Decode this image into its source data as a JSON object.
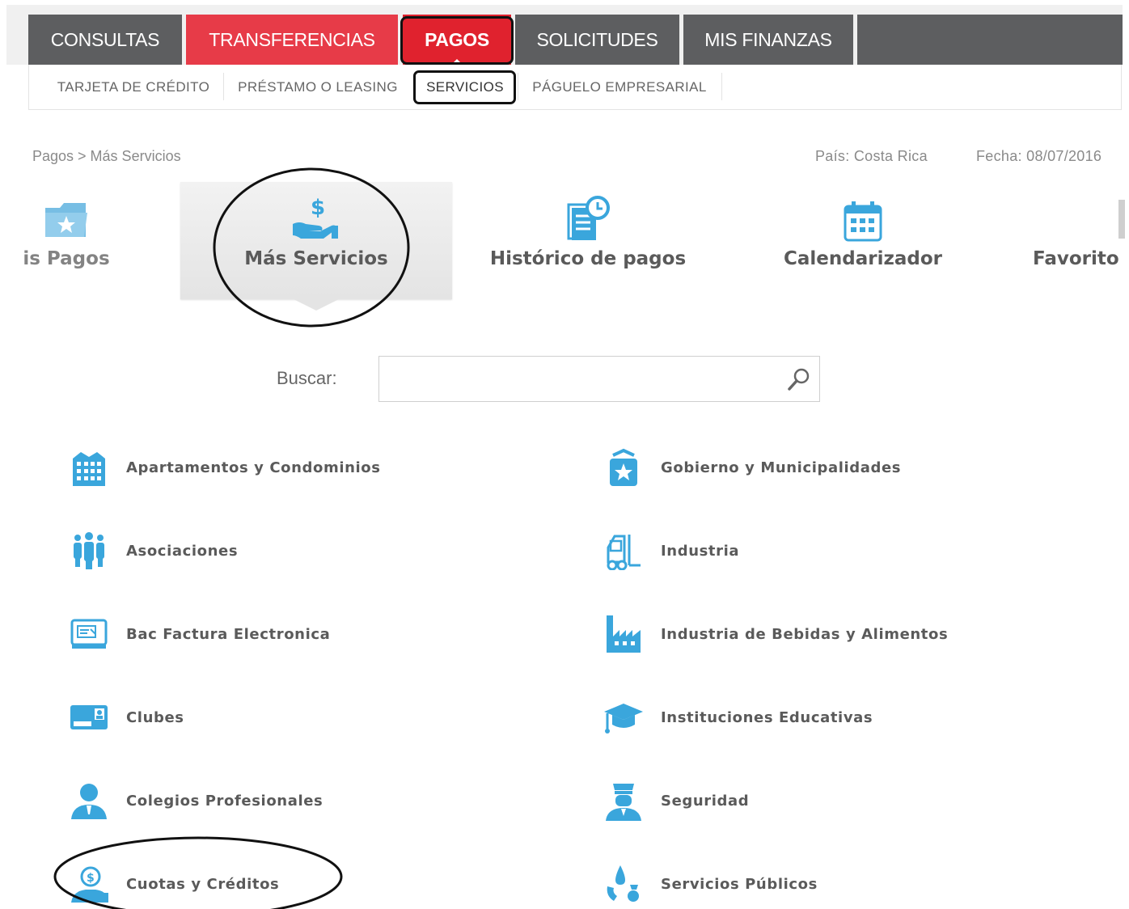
{
  "main_nav": {
    "tabs": [
      {
        "label": "CONSULTAS"
      },
      {
        "label": "TRANSFERENCIAS"
      },
      {
        "label": "PAGOS"
      },
      {
        "label": "SOLICITUDES"
      },
      {
        "label": "MIS FINANZAS"
      }
    ]
  },
  "sub_nav": {
    "items": [
      {
        "label": "TARJETA DE CRÉDITO"
      },
      {
        "label": "PRÉSTAMO O LEASING"
      },
      {
        "label": "SERVICIOS"
      },
      {
        "label": "PÁGUELO EMPRESARIAL"
      }
    ]
  },
  "breadcrumb": "Pagos > Más Servicios",
  "meta": {
    "country_label": "País:",
    "country": "Costa Rica",
    "date_label": "Fecha:",
    "date": "08/07/2016"
  },
  "carousel": {
    "items": [
      {
        "label": "is Pagos",
        "icon": "folder-star-icon"
      },
      {
        "label": "Más Servicios",
        "icon": "hand-dollar-icon"
      },
      {
        "label": "Histórico de pagos",
        "icon": "document-clock-icon"
      },
      {
        "label": "Calendarizador",
        "icon": "calendar-icon"
      },
      {
        "label": "Favorito",
        "icon": "favorites-icon"
      }
    ]
  },
  "search": {
    "label": "Buscar:",
    "value": "",
    "placeholder": ""
  },
  "services": {
    "left": [
      {
        "label": "Apartamentos y Condominios",
        "icon": "building-icon"
      },
      {
        "label": "Asociaciones",
        "icon": "people-group-icon"
      },
      {
        "label": "Bac Factura Electronica",
        "icon": "monitor-invoice-icon"
      },
      {
        "label": "Clubes",
        "icon": "membership-card-icon"
      },
      {
        "label": "Colegios Profesionales",
        "icon": "professional-person-icon"
      },
      {
        "label": "Cuotas y Créditos",
        "icon": "person-credit-icon"
      }
    ],
    "right": [
      {
        "label": "Gobierno y Municipalidades",
        "icon": "government-badge-icon"
      },
      {
        "label": "Industria",
        "icon": "forklift-icon"
      },
      {
        "label": "Industria de Bebidas y Alimentos",
        "icon": "factory-icon"
      },
      {
        "label": "Instituciones Educativas",
        "icon": "graduation-cap-icon"
      },
      {
        "label": "Seguridad",
        "icon": "security-guard-icon"
      },
      {
        "label": "Servicios Públicos",
        "icon": "utilities-icon"
      }
    ]
  },
  "colors": {
    "nav_dark": "#5d5e60",
    "nav_red": "#e73b48",
    "nav_active": "#e0222e",
    "icon_blue": "#3aa6dc",
    "text": "#5a5a5a"
  }
}
